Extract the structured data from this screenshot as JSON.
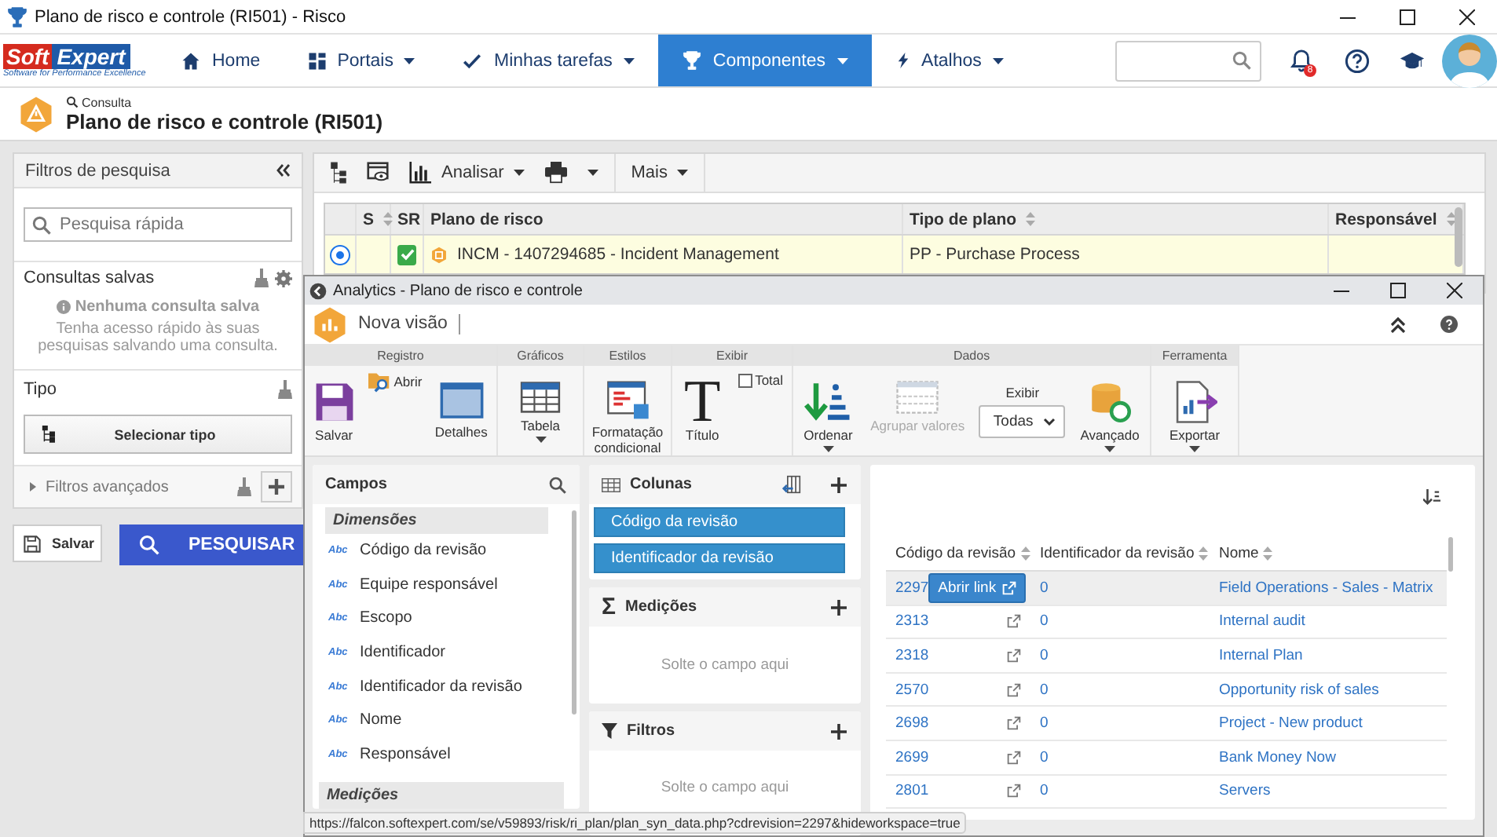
{
  "window": {
    "title": "Plano de risco e controle (RI501) - Risco"
  },
  "navbar": {
    "logo": {
      "word_1": "Soft",
      "word_2": "Expert",
      "tagline": "Software for Performance Excellence"
    },
    "menu": [
      {
        "label": "Home",
        "dropdown": false,
        "selected": false
      },
      {
        "label": "Portais",
        "dropdown": true,
        "selected": false
      },
      {
        "label": "Minhas tarefas",
        "dropdown": true,
        "selected": false
      },
      {
        "label": "Componentes",
        "dropdown": true,
        "selected": true
      },
      {
        "label": "Atalhos",
        "dropdown": true,
        "selected": false
      }
    ],
    "notification_count": "8"
  },
  "header": {
    "breadcrumb": "Consulta",
    "title": "Plano de risco e controle (RI501)"
  },
  "filters": {
    "title": "Filtros de pesquisa",
    "quick_search": {
      "placeholder": "Pesquisa rápida"
    },
    "saved": {
      "title": "Consultas salvas",
      "empty_title": "Nenhuma consulta salva",
      "empty_text": "Tenha acesso rápido às suas pesquisas salvando uma consulta."
    },
    "type": {
      "title": "Tipo",
      "button": "Selecionar tipo"
    },
    "advanced": {
      "title": "Filtros avançados",
      "expanded": false
    },
    "save_button": "Salvar",
    "search_button": "PESQUISAR"
  },
  "toolbar": {
    "analyze": "Analisar",
    "more": "Mais"
  },
  "grid": {
    "columns": [
      {
        "label": "S",
        "sortable": true
      },
      {
        "label": "SR",
        "sortable": false
      },
      {
        "label": "Plano de risco",
        "sortable": false
      },
      {
        "label": "Tipo de plano",
        "sortable": true
      },
      {
        "label": "Responsável",
        "sortable": true
      }
    ],
    "rows": [
      {
        "selected": true,
        "sr_checked": true,
        "plan": "INCM - 1407294685 - Incident Management",
        "type": "PP - Purchase Process"
      }
    ]
  },
  "analytics": {
    "title": "Analytics - Plano de risco e controle",
    "view_name": "Nova visão",
    "ribbon": [
      {
        "label": "Registro",
        "items": [
          {
            "kind": "large",
            "label": "Salvar",
            "dropdown": false,
            "disabled": false
          },
          {
            "kind": "small",
            "label": "Abrir",
            "dropdown": false,
            "disabled": false
          },
          {
            "kind": "large",
            "label": "Detalhes",
            "dropdown": false,
            "disabled": false
          }
        ]
      },
      {
        "label": "Gráficos",
        "items": [
          {
            "kind": "large",
            "label": "Tabela",
            "dropdown": true,
            "disabled": false
          }
        ]
      },
      {
        "label": "Estilos",
        "items": [
          {
            "kind": "large",
            "label": "Formatação condicional",
            "dropdown": false,
            "disabled": false
          }
        ]
      },
      {
        "label": "Exibir",
        "items": [
          {
            "kind": "glyph",
            "glyph": "T",
            "label": "Título",
            "dropdown": false,
            "disabled": false
          },
          {
            "kind": "checkbox",
            "label": "Total",
            "checked": false
          }
        ]
      },
      {
        "label": "Dados",
        "items": [
          {
            "kind": "large",
            "label": "Ordenar",
            "dropdown": true,
            "disabled": false
          },
          {
            "kind": "large",
            "label": "Agrupar valores",
            "dropdown": false,
            "disabled": true
          },
          {
            "kind": "select",
            "label": "Exibir",
            "value": "Todas"
          },
          {
            "kind": "large",
            "label": "Avançado",
            "dropdown": true,
            "disabled": false
          }
        ]
      },
      {
        "label": "Ferramenta",
        "items": [
          {
            "kind": "large",
            "label": "Exportar",
            "dropdown": true,
            "disabled": false
          }
        ]
      }
    ],
    "fields": {
      "title": "Campos",
      "sections": [
        {
          "title": "Dimensões",
          "items": [
            {
              "type": "Abc",
              "label": "Código da revisão"
            },
            {
              "type": "Abc",
              "label": "Equipe responsável"
            },
            {
              "type": "Abc",
              "label": "Escopo"
            },
            {
              "type": "Abc",
              "label": "Identificador"
            },
            {
              "type": "Abc",
              "label": "Identificador da revisão"
            },
            {
              "type": "Abc",
              "label": "Nome"
            },
            {
              "type": "Abc",
              "label": "Responsável"
            }
          ]
        },
        {
          "title": "Medições"
        }
      ]
    },
    "columns_panel": {
      "title": "Colunas",
      "items": [
        "Código da revisão",
        "Identificador da revisão"
      ]
    },
    "measures_panel": {
      "glyph": "Σ",
      "title": "Medições",
      "drop_hint": "Solte o campo aqui"
    },
    "filters_panel": {
      "title": "Filtros",
      "drop_hint": "Solte o campo aqui"
    },
    "table": {
      "columns": [
        "Código da revisão",
        "Identificador da revisão",
        "Nome"
      ],
      "link_button": "Abrir link",
      "rows": [
        {
          "code": "2297",
          "id": "0",
          "name": "Field Operations - Sales - Matrix",
          "hovered": true
        },
        {
          "code": "2313",
          "id": "0",
          "name": "Internal audit",
          "hovered": false
        },
        {
          "code": "2318",
          "id": "0",
          "name": "Internal Plan",
          "hovered": false
        },
        {
          "code": "2570",
          "id": "0",
          "name": "Opportunity risk of sales",
          "hovered": false
        },
        {
          "code": "2698",
          "id": "0",
          "name": "Project - New product",
          "hovered": false
        },
        {
          "code": "2699",
          "id": "0",
          "name": "Bank Money Now",
          "hovered": false
        },
        {
          "code": "2801",
          "id": "0",
          "name": "Servers",
          "hovered": false
        }
      ]
    }
  },
  "status_url": "https://falcon.softexpert.com/se/v59893/risk/ri_plan/plan_syn_data.php?cdrevision=2297&hideworkspace=true"
}
